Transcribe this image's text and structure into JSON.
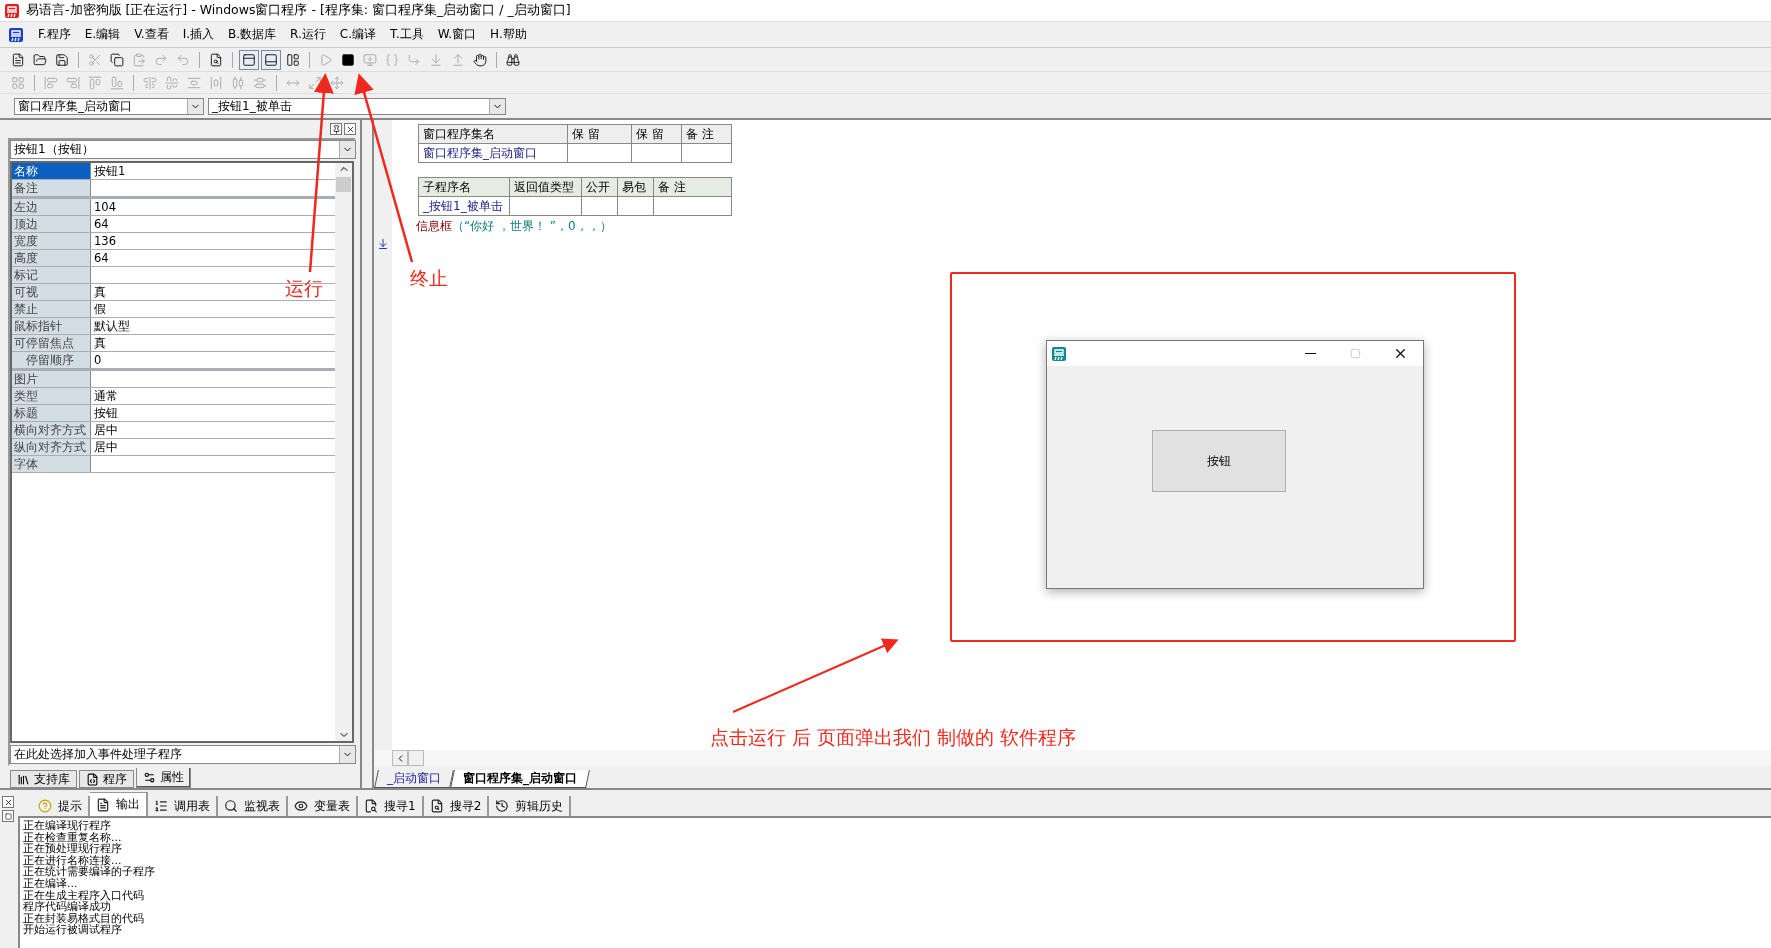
{
  "window": {
    "title": "易语言-加密狗版 [正在运行] - Windows窗口程序 - [程序集: 窗口程序集_启动窗口 / _启动窗口]"
  },
  "menu": [
    "F.程序",
    "E.编辑",
    "V.查看",
    "I.插入",
    "B.数据库",
    "R.运行",
    "C.编译",
    "T.工具",
    "W.窗口",
    "H.帮助"
  ],
  "toolbars": [
    {
      "groups": [
        [
          {
            "disabled": false
          },
          {
            "disabled": false
          },
          {
            "disabled": false
          }
        ],
        [
          {
            "disabled": true
          },
          {
            "disabled": false
          },
          {
            "disabled": true
          },
          {
            "disabled": true
          },
          {
            "disabled": true
          }
        ],
        [
          {
            "disabled": false
          }
        ],
        [
          {
            "disabled": false,
            "pressed": true
          },
          {
            "disabled": false,
            "pressed": true
          },
          {
            "disabled": false,
            "pressed": false
          }
        ],
        [
          {
            "disabled": true
          },
          {
            "disabled": false
          },
          {
            "disabled": true
          },
          {
            "disabled": true
          },
          {
            "disabled": true
          },
          {
            "disabled": true
          },
          {
            "disabled": true
          },
          {
            "disabled": false
          }
        ],
        [
          {
            "disabled": false
          }
        ]
      ]
    },
    {
      "groups": [
        [
          {
            "disabled": true
          }
        ],
        [
          {
            "disabled": true
          },
          {
            "disabled": true
          },
          {
            "disabled": true
          },
          {
            "disabled": true
          }
        ],
        [
          {
            "disabled": true
          },
          {
            "disabled": true
          },
          {
            "disabled": true
          },
          {
            "disabled": true
          },
          {
            "disabled": true
          },
          {
            "disabled": true
          }
        ],
        [
          {
            "disabled": true
          },
          {
            "disabled": true
          },
          {
            "disabled": true
          }
        ]
      ]
    }
  ],
  "selectors": {
    "program_set": "窗口程序集_启动窗口",
    "subroutine": "_按钮1_被单击"
  },
  "properties_panel": {
    "object": "按钮1（按钮）",
    "groups": [
      [
        {
          "name": "名称",
          "value": "按钮1",
          "selected": true
        },
        {
          "name": "备注",
          "selected": false
        }
      ],
      [
        {
          "name": "左边",
          "value": "104",
          "selected": false
        },
        {
          "name": "顶边",
          "value": "64",
          "selected": false
        },
        {
          "name": "宽度",
          "value": "136",
          "selected": false
        },
        {
          "name": "高度",
          "value": "64",
          "selected": false
        },
        {
          "name": "标记",
          "selected": false
        },
        {
          "name": "可视",
          "value": "真",
          "selected": false
        },
        {
          "name": "禁止",
          "value": "假",
          "selected": false
        },
        {
          "name": "鼠标指针",
          "value": "默认型",
          "selected": false
        },
        {
          "name": "可停留焦点",
          "value": "真",
          "selected": false,
          "children": [
            {
              "name": "停留顺序",
              "value": "0",
              "selected": false
            }
          ]
        }
      ],
      [
        {
          "name": "图片",
          "selected": false
        },
        {
          "name": "类型",
          "value": "通常",
          "selected": false
        },
        {
          "name": "标题",
          "value": "按钮",
          "selected": false
        },
        {
          "name": "横向对齐方式",
          "value": "居中",
          "selected": false
        },
        {
          "name": "纵向对齐方式",
          "value": "居中",
          "selected": false
        },
        {
          "name": "字体",
          "selected": false
        }
      ]
    ],
    "event_selector": "在此处选择加入事件处理子程序",
    "tabs": [
      {
        "label": "支持库",
        "selected": false
      },
      {
        "label": "程序",
        "selected": false
      },
      {
        "label": "属性",
        "selected": true
      }
    ]
  },
  "code": {
    "program_set_table": {
      "columns": [
        "窗口程序集名",
        "保 留",
        "保 留",
        "备 注"
      ],
      "row": [
        "窗口程序集_启动窗口"
      ]
    },
    "subroutine_table": {
      "columns": [
        "子程序名",
        "返回值类型",
        "公开",
        "易包",
        "备 注"
      ],
      "row": [
        "_按钮1_被单击"
      ]
    },
    "line": {
      "function": "信息框",
      "arguments": "（“你好 ，世界！ ”，0，，）"
    },
    "tabs": [
      {
        "label": "_启动窗口",
        "selected": false
      },
      {
        "label": "窗口程序集_启动窗口",
        "selected": true
      }
    ]
  },
  "output_panel": {
    "tabs": [
      {
        "label": "提示",
        "selected": false
      },
      {
        "label": "输出",
        "selected": true
      },
      {
        "label": "调用表",
        "selected": false
      },
      {
        "label": "监视表",
        "selected": false
      },
      {
        "label": "变量表",
        "selected": false
      },
      {
        "label": "搜寻1",
        "selected": false
      },
      {
        "label": "搜寻2",
        "selected": false
      },
      {
        "label": "剪辑历史",
        "selected": false
      }
    ],
    "lines": [
      "正在编译现行程序",
      "正在检查重复名称...",
      "正在预处理现行程序",
      "正在进行名称连接...",
      "正在统计需要编译的子程序",
      "正在编译...",
      "正在生成主程序入口代码",
      "程序代码编译成功",
      "正在封装易格式目的代码",
      "开始运行被调试程序"
    ]
  },
  "running_window": {
    "button": "按钮",
    "maximize_disabled": true
  },
  "annotations": {
    "run_label": "运行",
    "stop_label": "终止",
    "caption": "点击运行 后 页面弹出我们 制做的 软件程序"
  }
}
